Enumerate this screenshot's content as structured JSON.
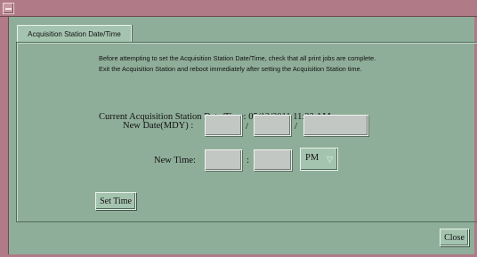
{
  "tab": {
    "label": "Acquisition Station Date/Time"
  },
  "instructions": {
    "line1": "Before attempting to set the Acquisition Station Date/Time, check that all print jobs are complete.",
    "line2": "Exit the Acquisition Station and reboot immediately after setting the Acquisition Station time."
  },
  "current_datetime": "Current Acquisition Station Date/Time: 05/12/2011 11:22 AM",
  "new_date": {
    "label": "New Date(MDY) :",
    "separator": "/",
    "month": "",
    "day": "",
    "year": ""
  },
  "new_time": {
    "label": "New Time:",
    "separator": ":",
    "hour": "",
    "minute": "",
    "ampm": "PM"
  },
  "buttons": {
    "set_time": "Set Time",
    "close": "Close"
  },
  "icons": {
    "sysmenu": "window-menu-icon",
    "dropdown": "dropdown-arrow-icon"
  }
}
